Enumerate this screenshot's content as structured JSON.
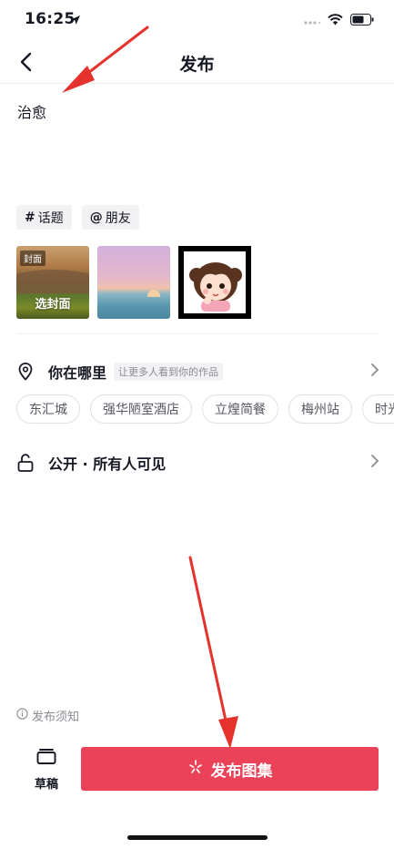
{
  "status_bar": {
    "time": "16:25"
  },
  "nav": {
    "title": "发布"
  },
  "caption": {
    "text": "治愈"
  },
  "tags": [
    {
      "symbol": "#",
      "label": "话题"
    },
    {
      "symbol": "@",
      "label": "朋友"
    }
  ],
  "media": {
    "cover_badge": "封面",
    "cover_label": "选封面"
  },
  "location": {
    "title": "你在哪里",
    "hint": "让更多人看到你的作品",
    "pois": [
      "东汇城",
      "强华陋室酒店",
      "立煌简餐",
      "梅州站",
      "时光"
    ]
  },
  "privacy": {
    "title": "公开 · 所有人可见"
  },
  "footer": {
    "notice": "发布须知",
    "draft_label": "草稿",
    "publish_label": "发布图集"
  },
  "colors": {
    "accent": "#ea4359",
    "annotation": "#e5322d"
  }
}
